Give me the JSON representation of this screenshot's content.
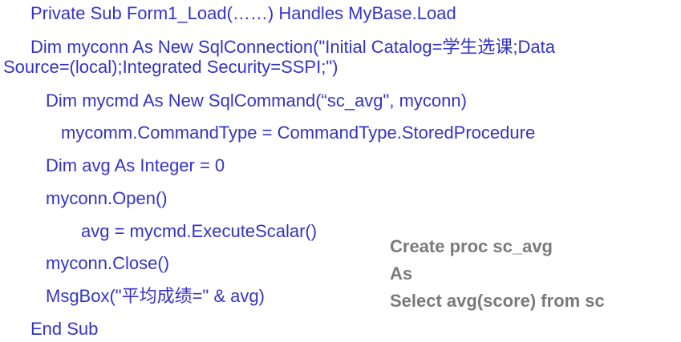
{
  "code": {
    "line1": "Private Sub Form1_Load(……) Handles MyBase.Load",
    "line2a": "Dim myconn As New SqlConnection(\"Initial Catalog=学生选课;Data",
    "line2b": "Source=(local);Integrated Security=SSPI;\")",
    "line3": "Dim mycmd As New SqlCommand(“sc_avg\", myconn)",
    "line4": "mycomm.CommandType = CommandType.StoredProcedure",
    "line5": "Dim avg As Integer = 0",
    "line6": "myconn.Open()",
    "line7": "avg = mycmd.ExecuteScalar()",
    "line8": "myconn.Close()",
    "line9": "MsgBox(\"平均成绩=\" & avg)",
    "line10": "End Sub"
  },
  "sql": {
    "line1": "Create proc sc_avg",
    "line2": "As",
    "line3": "Select  avg(score)  from sc"
  },
  "colors": {
    "code": "#3333c8",
    "sql": "#7a7a7a",
    "background": "#ffffff"
  }
}
